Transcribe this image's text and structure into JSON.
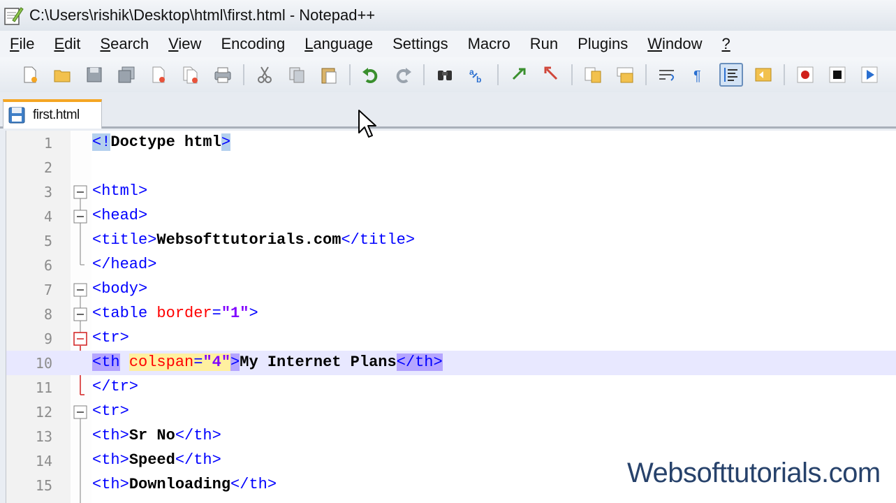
{
  "window": {
    "title": "C:\\Users\\rishik\\Desktop\\html\\first.html - Notepad++"
  },
  "menu": [
    {
      "label": "File",
      "u": "F",
      "rest": "ile"
    },
    {
      "label": "Edit",
      "u": "E",
      "rest": "dit"
    },
    {
      "label": "Search",
      "u": "S",
      "rest": "earch"
    },
    {
      "label": "View",
      "u": "V",
      "rest": "iew"
    },
    {
      "label": "Encoding",
      "u": "",
      "rest": "Encoding"
    },
    {
      "label": "Language",
      "u": "L",
      "rest": "anguage"
    },
    {
      "label": "Settings",
      "u": "",
      "rest": "Settings"
    },
    {
      "label": "Macro",
      "u": "",
      "rest": "Macro"
    },
    {
      "label": "Run",
      "u": "",
      "rest": "Run"
    },
    {
      "label": "Plugins",
      "u": "",
      "rest": "Plugins"
    },
    {
      "label": "Window",
      "u": "W",
      "rest": "indow"
    },
    {
      "label": "?",
      "u": "?",
      "rest": ""
    }
  ],
  "toolbar": {
    "icons": [
      "new-file-icon",
      "open-file-icon",
      "save-icon",
      "save-all-icon",
      "close-icon",
      "close-all-icon",
      "print-icon",
      "cut-icon",
      "copy-icon",
      "paste-icon",
      "undo-icon",
      "redo-icon",
      "find-icon",
      "replace-icon",
      "zoom-in-icon",
      "zoom-out-icon",
      "sync-vertical-icon",
      "sync-horizontal-icon",
      "word-wrap-icon",
      "show-all-chars-icon",
      "indent-guide-icon",
      "doc-map-icon",
      "record-macro-icon",
      "stop-macro-icon",
      "play-macro-icon"
    ]
  },
  "tab": {
    "label": "first.html"
  },
  "editor": {
    "lines": [
      {
        "n": "1"
      },
      {
        "n": "2"
      },
      {
        "n": "3"
      },
      {
        "n": "4"
      },
      {
        "n": "5"
      },
      {
        "n": "6"
      },
      {
        "n": "7"
      },
      {
        "n": "8"
      },
      {
        "n": "9"
      },
      {
        "n": "10"
      },
      {
        "n": "11"
      },
      {
        "n": "12"
      },
      {
        "n": "13"
      },
      {
        "n": "14"
      },
      {
        "n": "15"
      }
    ],
    "tokens": {
      "l1_open": "<!",
      "l1_text": "Doctype html",
      "l1_close": ">",
      "l3": "<html>",
      "l4": "<head>",
      "l5_open": "<title>",
      "l5_text": "Websofttutorials.com",
      "l5_close": "</title>",
      "l6": "</head>",
      "l7": "<body>",
      "l8_tag": "<table ",
      "l8_attr": "border",
      "l8_eq": "=",
      "l8_val": "\"1\"",
      "l8_close": ">",
      "l9": "<tr>",
      "l10_open": "<th",
      "l10_sp": " ",
      "l10_attr": "colspan",
      "l10_eq": "=",
      "l10_val": "\"4\"",
      "l10_gt": ">",
      "l10_text": "My Internet Plans",
      "l10_close": "</th>",
      "l11": "</tr>",
      "l12": "<tr>",
      "l13_open": "<th>",
      "l13_text": "Sr No",
      "l13_close": "</th>",
      "l14_open": "<th>",
      "l14_text": "Speed",
      "l14_close": "</th>",
      "l15_open": "<th>",
      "l15_text": "Downloading",
      "l15_close": "</th>"
    }
  },
  "watermark": "Websofttutorials.com",
  "colors": {
    "tag": "#0000ff",
    "attr": "#ff0000",
    "value": "#8000ff",
    "current_line": "#e8e8ff",
    "tab_accent": "#f5a623"
  }
}
